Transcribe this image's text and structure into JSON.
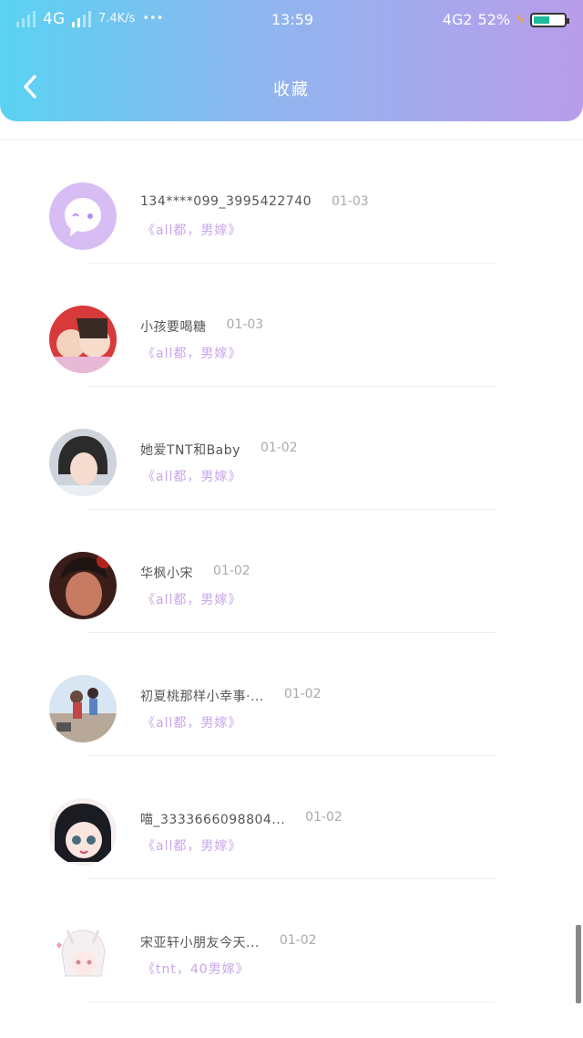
{
  "status_bar": {
    "network": "4G",
    "speed": "7.4K/s",
    "dots": "•••",
    "time": "13:59",
    "network2": "4G2",
    "battery": "52%",
    "battery_level": 0.52
  },
  "header": {
    "title": "收藏",
    "back_icon": "chevron-left-icon"
  },
  "colors": {
    "gradient_start": "#5ad2f2",
    "gradient_end": "#b99cea",
    "subtitle": "#c8a6ea"
  },
  "items": [
    {
      "name": "134****099_3995422740",
      "date": "01-03",
      "subtitle": "《all都，男嫁》",
      "avatar": "chat-bubble-icon"
    },
    {
      "name": "小孩要喝糖",
      "date": "01-03",
      "subtitle": "《all都，男嫁》",
      "avatar": "user-photo"
    },
    {
      "name": "她爱TNT和Baby",
      "date": "01-02",
      "subtitle": "《all都，男嫁》",
      "avatar": "user-photo"
    },
    {
      "name": "华枫小宋",
      "date": "01-02",
      "subtitle": "《all都，男嫁》",
      "avatar": "user-photo"
    },
    {
      "name": "初夏桃那样小幸事·...",
      "date": "01-02",
      "subtitle": "《all都，男嫁》",
      "avatar": "user-photo"
    },
    {
      "name": "喵_3333666098804...",
      "date": "01-02",
      "subtitle": "《all都，男嫁》",
      "avatar": "anime-avatar"
    },
    {
      "name": "宋亚轩小朋友今天...",
      "date": "01-02",
      "subtitle": "《tnt，40男嫁》",
      "avatar": "anime-avatar"
    }
  ]
}
